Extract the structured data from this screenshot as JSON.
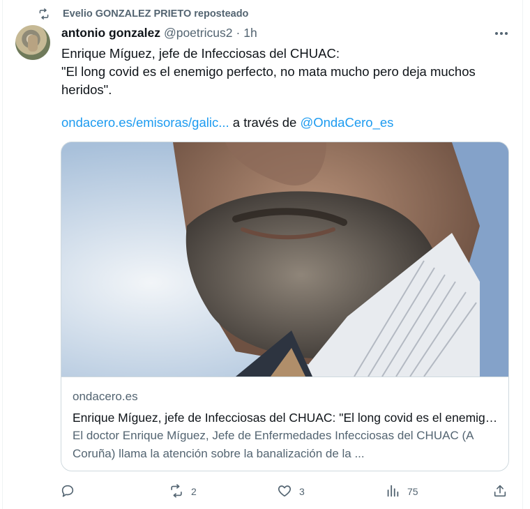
{
  "repost": {
    "label": "Evelio GONZALEZ PRIETO reposteado",
    "icon": "repost-icon"
  },
  "author": {
    "name": "antonio gonzalez",
    "handle": "@poetricus2",
    "separator": "·",
    "time": "1h"
  },
  "tweet": {
    "text": "Enrique Míguez, jefe de Infecciosas del CHUAC:\n\"El long covid es el enemigo perfecto, no mata mucho pero deja muchos heridos\".",
    "link_text": "ondacero.es/emisoras/galic...",
    "via_text": "a través de",
    "mention": "@OndaCero_es"
  },
  "card": {
    "domain": "ondacero.es",
    "title": "Enrique Míguez, jefe de Infecciosas del CHUAC: \"El long covid es el enemigo perfecto, no mata mucho pero deja muchos heridos\"",
    "description": "El doctor Enrique Míguez, Jefe de Enfermedades Infecciosas del CHUAC (A Coruña) llama la atención sobre la banalización de la ..."
  },
  "actions": {
    "reply": {
      "icon": "reply-icon",
      "count": ""
    },
    "retweet": {
      "icon": "retweet-icon",
      "count": "2"
    },
    "like": {
      "icon": "heart-icon",
      "count": "3"
    },
    "views": {
      "icon": "views-icon",
      "count": "75"
    },
    "share": {
      "icon": "share-icon"
    }
  },
  "colors": {
    "text": "#0f1419",
    "secondary": "#536471",
    "link": "#1d9bf0",
    "border": "#cfd9de"
  }
}
